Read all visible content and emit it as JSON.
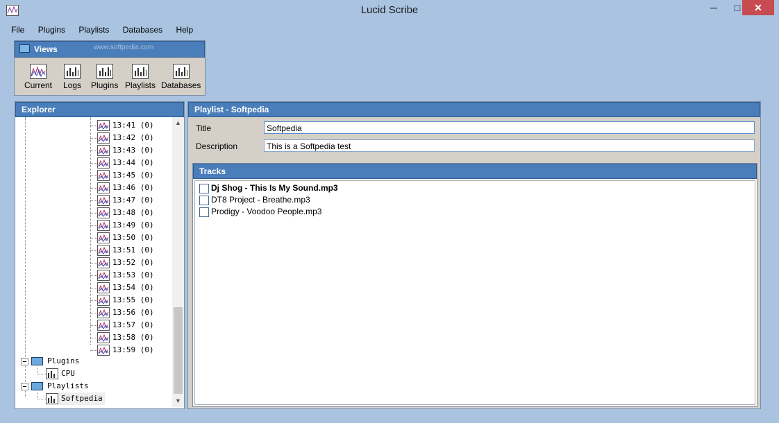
{
  "window": {
    "title": "Lucid Scribe",
    "min_glyph": "─",
    "max_glyph": "□",
    "close_glyph": "✕"
  },
  "menu": [
    "File",
    "Plugins",
    "Playlists",
    "Databases",
    "Help"
  ],
  "views": {
    "header": "Views",
    "watermark": "www.softpedia.com",
    "buttons": [
      "Current",
      "Logs",
      "Plugins",
      "Playlists",
      "Databases"
    ]
  },
  "explorer": {
    "header": "Explorer",
    "time_entries": [
      "13:41 (0)",
      "13:42 (0)",
      "13:43 (0)",
      "13:44 (0)",
      "13:45 (0)",
      "13:46 (0)",
      "13:47 (0)",
      "13:48 (0)",
      "13:49 (0)",
      "13:50 (0)",
      "13:51 (0)",
      "13:52 (0)",
      "13:53 (0)",
      "13:54 (0)",
      "13:55 (0)",
      "13:56 (0)",
      "13:57 (0)",
      "13:58 (0)",
      "13:59 (0)"
    ],
    "plugins_label": "Plugins",
    "plugin_items": [
      "CPU"
    ],
    "playlists_label": "Playlists",
    "playlist_items": [
      "Softpedia"
    ]
  },
  "playlist": {
    "header": "Playlist - Softpedia",
    "title_label": "Title",
    "title_value": "Softpedia",
    "description_label": "Description",
    "description_value": " This is a Softpedia test",
    "tracks_header": "Tracks",
    "tracks": [
      "Dj Shog - This Is My Sound.mp3",
      "DT8 Project - Breathe.mp3",
      "Prodigy - Voodoo People.mp3"
    ]
  },
  "colors": {
    "accent": "#4a7ebb",
    "frame": "#a9c3e0",
    "close": "#c74b50"
  }
}
